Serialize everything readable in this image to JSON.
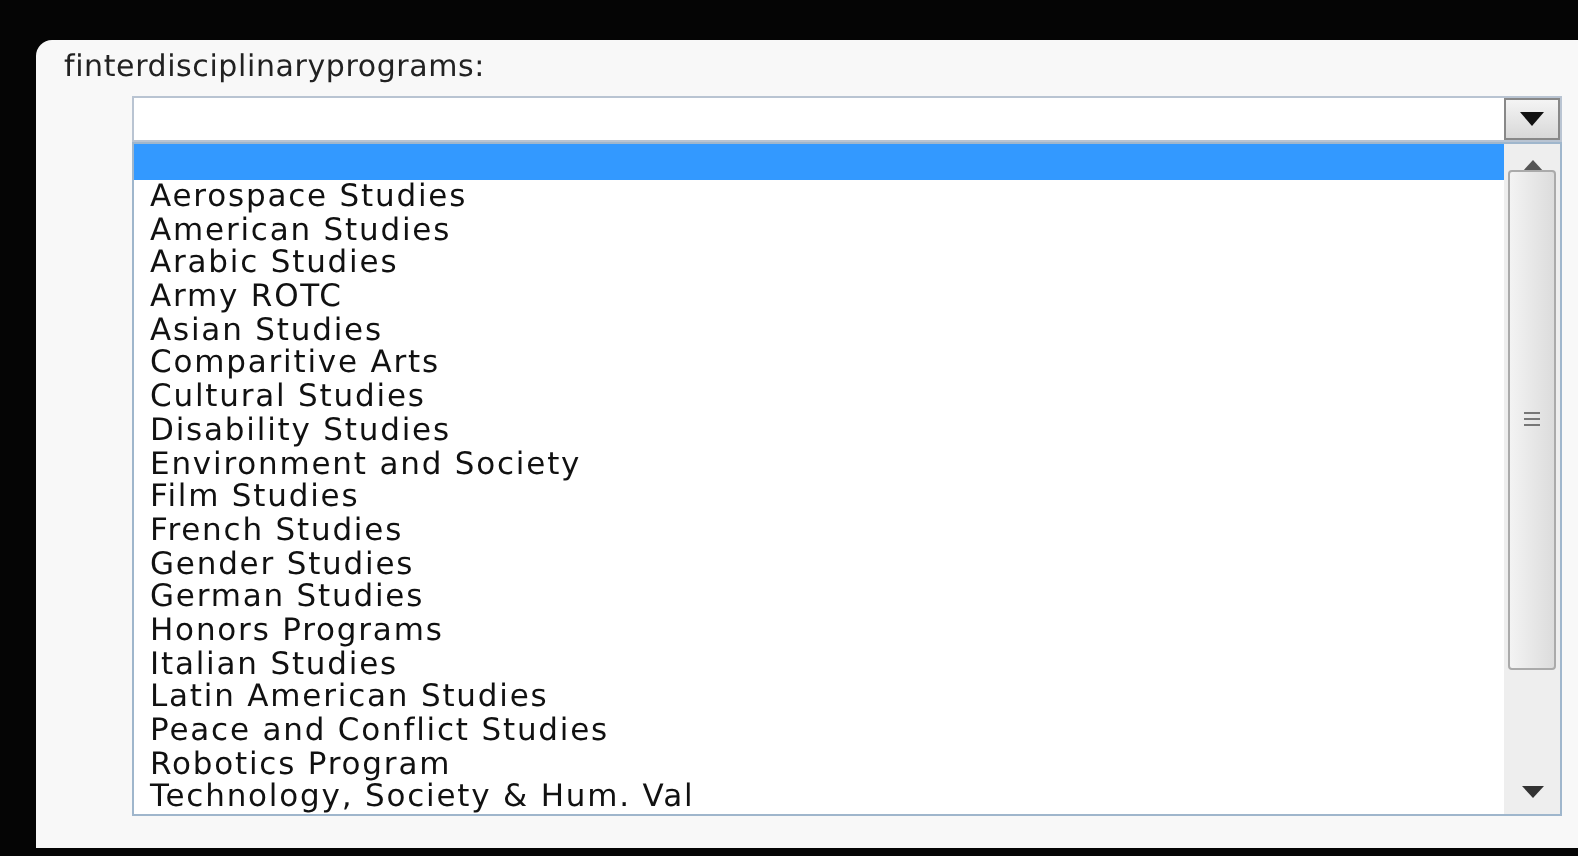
{
  "field_label": "finterdisciplinaryprograms:",
  "blank_option": {
    "selected": true
  },
  "options": [
    {
      "label": "Aerospace Studies",
      "selected": false
    },
    {
      "label": "American Studies",
      "selected": false
    },
    {
      "label": "Arabic Studies",
      "selected": false
    },
    {
      "label": "Army ROTC",
      "selected": false
    },
    {
      "label": "Asian Studies",
      "selected": false
    },
    {
      "label": "Comparitive Arts",
      "selected": false
    },
    {
      "label": "Cultural Studies",
      "selected": false
    },
    {
      "label": "Disability Studies",
      "selected": false
    },
    {
      "label": "Environment and Society",
      "selected": false
    },
    {
      "label": "Film Studies",
      "selected": false
    },
    {
      "label": "French Studies",
      "selected": false
    },
    {
      "label": "Gender Studies",
      "selected": false
    },
    {
      "label": "German Studies",
      "selected": false
    },
    {
      "label": "Honors Programs",
      "selected": false
    },
    {
      "label": "Italian Studies",
      "selected": false
    },
    {
      "label": "Latin American Studies",
      "selected": false
    },
    {
      "label": "Peace and Conflict Studies",
      "selected": false
    },
    {
      "label": "Robotics Program",
      "selected": false
    },
    {
      "label": "Technology, Society & Hum. Val",
      "selected": false
    }
  ]
}
